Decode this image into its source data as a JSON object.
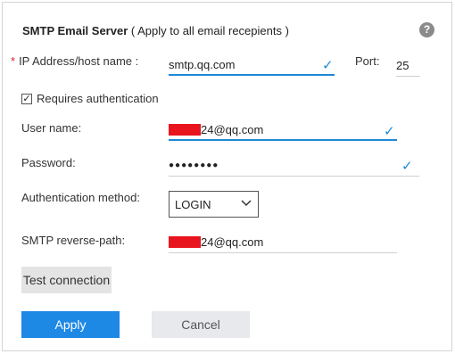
{
  "header": {
    "title_bold": "SMTP Email Server",
    "title_rest": "( Apply to all email recepients )",
    "help_icon": "?"
  },
  "form": {
    "required_marker": "*",
    "ip_label": "IP Address/host name :",
    "ip_value": "smtp.qq.com",
    "port_label": "Port:",
    "port_value": "25",
    "auth_checkbox_label": "Requires authentication",
    "auth_checked": "✓",
    "username_label": "User name:",
    "username_value_visible": "24@qq.com",
    "password_label": "Password:",
    "password_value": "●●●●●●●●",
    "auth_method_label": "Authentication method:",
    "auth_method_value": "LOGIN",
    "reverse_path_label": "SMTP reverse-path:",
    "reverse_path_value_visible": "24@qq.com",
    "check_glyph": "✓"
  },
  "buttons": {
    "test": "Test connection",
    "apply": "Apply",
    "cancel": "Cancel"
  },
  "colors": {
    "accent": "#1e88e5",
    "redaction": "#e8141e",
    "required": "#d9232e"
  }
}
